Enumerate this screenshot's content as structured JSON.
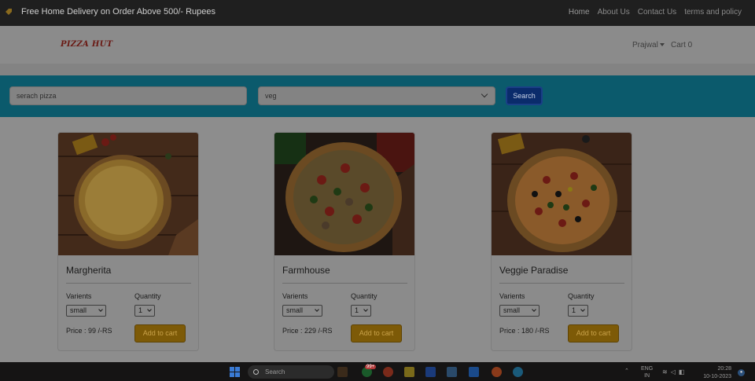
{
  "topbar": {
    "promo_text": "Free Home Delivery on Order Above 500/- Rupees",
    "links": [
      "Home",
      "About Us",
      "Contact Us",
      "terms and policy"
    ]
  },
  "header": {
    "logo_text": "PIZZA HUT",
    "user_name": "Prajwal",
    "cart_label": "Cart 0"
  },
  "search": {
    "placeholder": "serach pizza",
    "category_value": "veg",
    "button_label": "Search"
  },
  "products": [
    {
      "name": "Margherita",
      "variants_label": "Varients",
      "quantity_label": "Quantity",
      "variant_value": "small",
      "quantity_value": "1",
      "price_text": "Price : 99 /-RS",
      "add_label": "Add to cart"
    },
    {
      "name": "Farmhouse",
      "variants_label": "Varients",
      "quantity_label": "Quantity",
      "variant_value": "small",
      "quantity_value": "1",
      "price_text": "Price : 229 /-RS",
      "add_label": "Add to cart"
    },
    {
      "name": "Veggie Paradise",
      "variants_label": "Varients",
      "quantity_label": "Quantity",
      "variant_value": "small",
      "quantity_value": "1",
      "price_text": "Price : 180 /-RS",
      "add_label": "Add to cart"
    }
  ],
  "taskbar": {
    "search_label": "Search",
    "badge": "99+",
    "lang_top": "ENG",
    "lang_bottom": "IN",
    "time": "20:28",
    "date": "10-10-2023"
  },
  "colors": {
    "search_band": "#0b5a6c",
    "search_button": "#0a2b6b",
    "add_button": "#7d5a07",
    "logo": "#6a1a14"
  }
}
